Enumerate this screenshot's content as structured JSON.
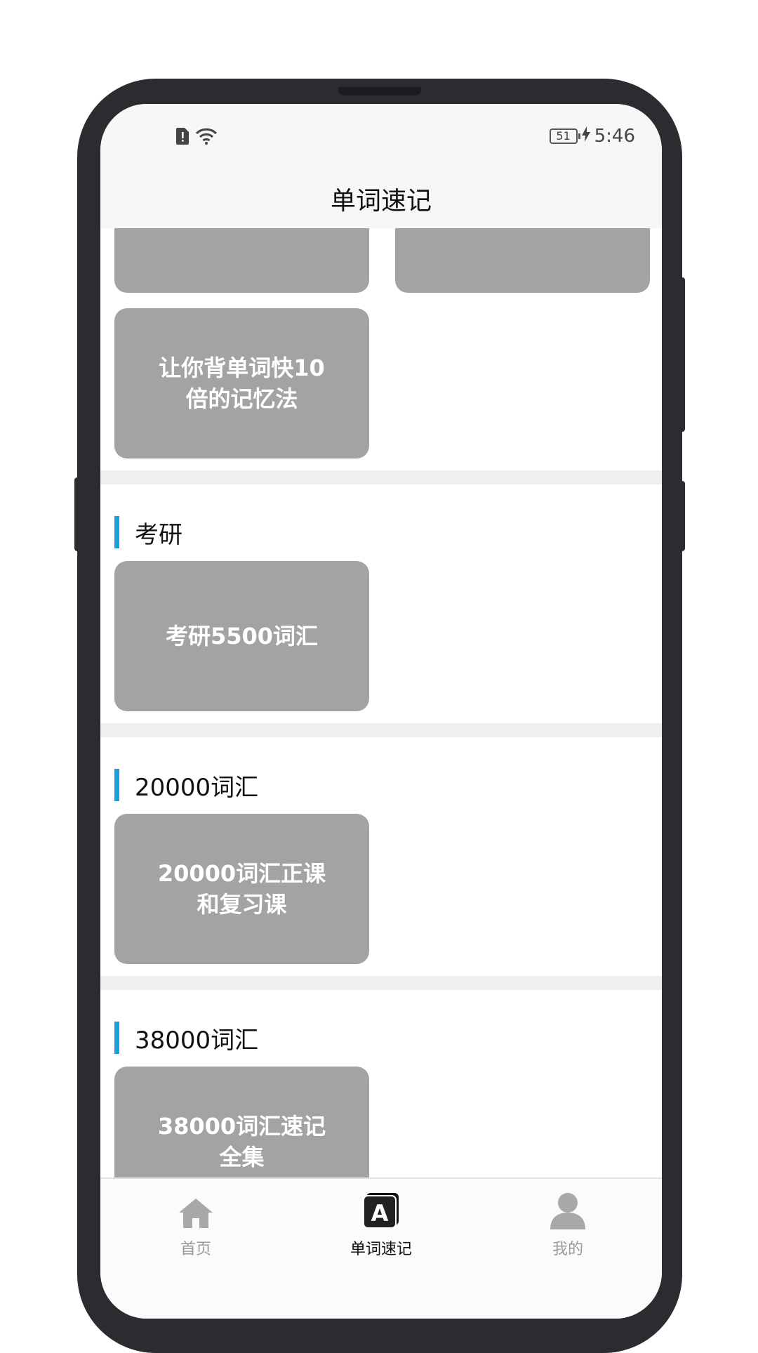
{
  "status_bar": {
    "time": "5:46",
    "battery": "51"
  },
  "header": {
    "title": "单词速记"
  },
  "sections": {
    "s0": {
      "cards": [
        "让你背单词快10倍的记忆法"
      ]
    },
    "s1": {
      "title": "考研",
      "cards": [
        "考研5500词汇"
      ]
    },
    "s2": {
      "title": "20000词汇",
      "cards": [
        "20000词汇正课和复习课"
      ]
    },
    "s3": {
      "title": "38000词汇",
      "cards": [
        "38000词汇速记全集"
      ]
    }
  },
  "bottom_nav": {
    "items": [
      {
        "label": "首页",
        "icon": "home-icon",
        "active": false
      },
      {
        "label": "单词速记",
        "icon": "letter-a-icon",
        "active": true
      },
      {
        "label": "我的",
        "icon": "user-icon",
        "active": false
      }
    ]
  },
  "colors": {
    "accent": "#1a9fe0",
    "card": "#a3a3a3",
    "divider": "#efefef"
  }
}
